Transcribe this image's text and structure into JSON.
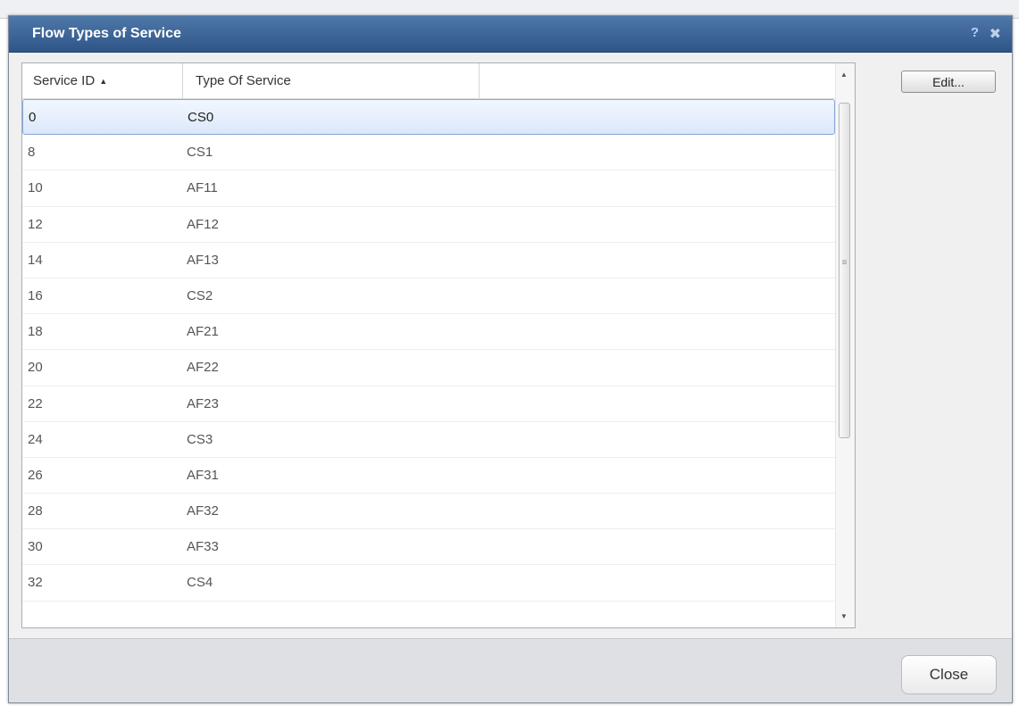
{
  "dialog": {
    "title": "Flow Types of Service",
    "help_glyph": "?",
    "close_glyph": "✖"
  },
  "grid": {
    "columns": [
      {
        "label": "Service ID",
        "sort_glyph": "▲"
      },
      {
        "label": "Type Of Service"
      }
    ],
    "rows": [
      {
        "id": "0",
        "type": "CS0",
        "selected": true
      },
      {
        "id": "8",
        "type": "CS1"
      },
      {
        "id": "10",
        "type": "AF11"
      },
      {
        "id": "12",
        "type": "AF12"
      },
      {
        "id": "14",
        "type": "AF13"
      },
      {
        "id": "16",
        "type": "CS2"
      },
      {
        "id": "18",
        "type": "AF21"
      },
      {
        "id": "20",
        "type": "AF22"
      },
      {
        "id": "22",
        "type": "AF23"
      },
      {
        "id": "24",
        "type": "CS3"
      },
      {
        "id": "26",
        "type": "AF31"
      },
      {
        "id": "28",
        "type": "AF32"
      },
      {
        "id": "30",
        "type": "AF33"
      },
      {
        "id": "32",
        "type": "CS4"
      }
    ]
  },
  "scrollbar": {
    "up_glyph": "▲",
    "down_glyph": "▼",
    "grip_glyph": "≡"
  },
  "buttons": {
    "edit_label": "Edit...",
    "close_label": "Close"
  },
  "colors": {
    "titlebar": "#3a6398",
    "selection_border": "#86a7d6",
    "footer": "#dfe0e3"
  }
}
